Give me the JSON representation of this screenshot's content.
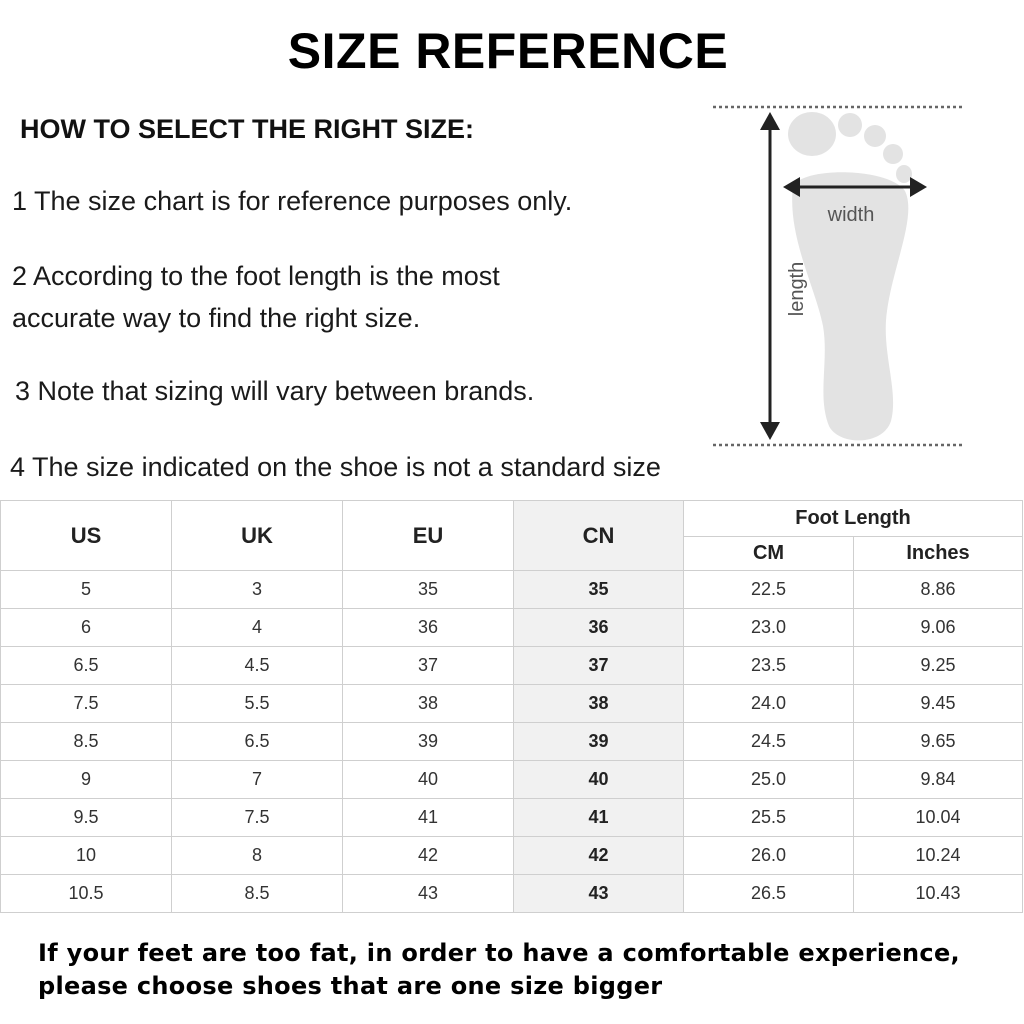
{
  "title": "SIZE REFERENCE",
  "howto": "HOW TO SELECT THE RIGHT SIZE:",
  "tips": [
    "1 The size chart is for reference purposes only.",
    "2 According to the foot length is the most",
    "accurate way to find the right size.",
    "3 Note that sizing will vary between brands.",
    "4 The size indicated on the shoe is not a standard size"
  ],
  "diagram": {
    "width_label": "width",
    "length_label": "length"
  },
  "table": {
    "headers": {
      "us": "US",
      "uk": "UK",
      "eu": "EU",
      "cn": "CN",
      "foot_length": "Foot Length",
      "cm": "CM",
      "inches": "Inches"
    },
    "rows": [
      [
        "5",
        "3",
        "35",
        "35",
        "22.5",
        "8.86"
      ],
      [
        "6",
        "4",
        "36",
        "36",
        "23.0",
        "9.06"
      ],
      [
        "6.5",
        "4.5",
        "37",
        "37",
        "23.5",
        "9.25"
      ],
      [
        "7.5",
        "5.5",
        "38",
        "38",
        "24.0",
        "9.45"
      ],
      [
        "8.5",
        "6.5",
        "39",
        "39",
        "24.5",
        "9.65"
      ],
      [
        "9",
        "7",
        "40",
        "40",
        "25.0",
        "9.84"
      ],
      [
        "9.5",
        "7.5",
        "41",
        "41",
        "25.5",
        "10.04"
      ],
      [
        "10",
        "8",
        "42",
        "42",
        "26.0",
        "10.24"
      ],
      [
        "10.5",
        "8.5",
        "43",
        "43",
        "26.5",
        "10.43"
      ]
    ]
  },
  "note": {
    "line1": "If your feet are too fat, in order to have a comfortable experience,",
    "line2": "please choose shoes that are one size bigger"
  }
}
